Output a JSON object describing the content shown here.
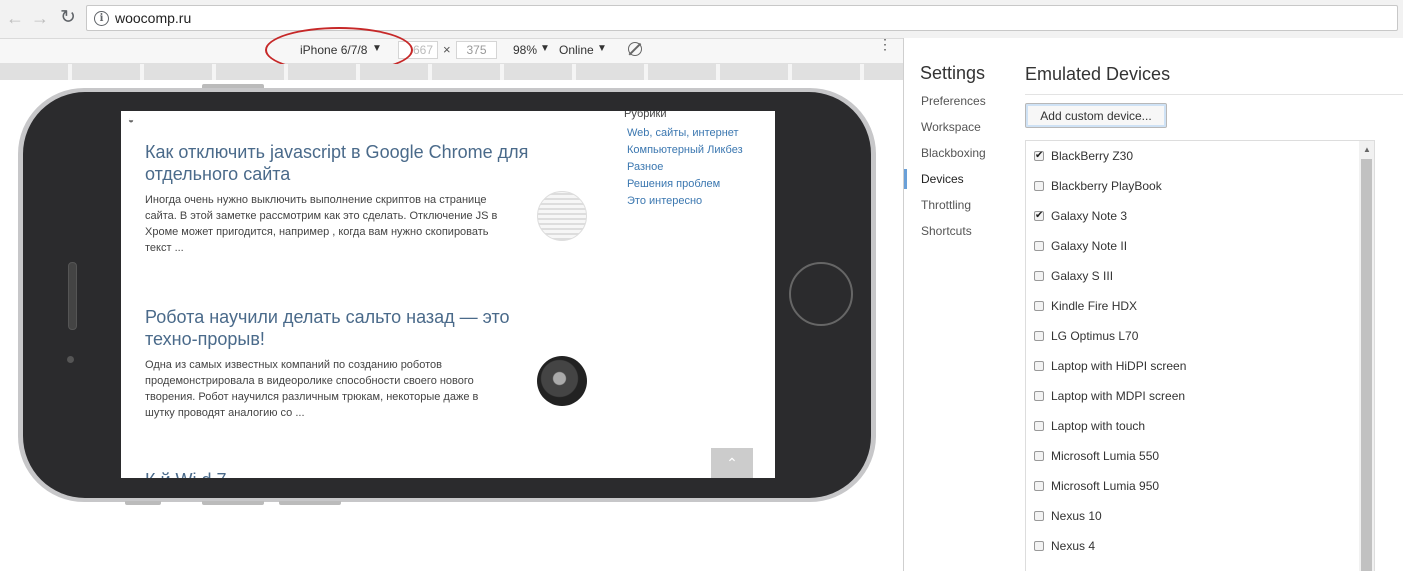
{
  "browser": {
    "url": "woocomp.ru",
    "back_icon": "←",
    "forward_icon": "→",
    "reload_icon": "↻",
    "info_icon": "i"
  },
  "device_toolbar": {
    "device": "iPhone 6/7/8",
    "width": "667",
    "times": "×",
    "height": "375",
    "zoom": "98%",
    "network": "Online",
    "caret": "▼",
    "kebab": "⋮",
    "highlight_color": "#c62828"
  },
  "screen": {
    "posts": [
      {
        "title": "Как отключить javascript в Google Chrome для отдельного сайта",
        "excerpt": "Иногда очень нужно выключить выполнение скриптов на странице сайта. В этой заметке рассмотрим как это сделать. Отключение JS в Хроме может пригодится, например , когда вам нужно скопировать текст ..."
      },
      {
        "title": "Робота научили делать сальто назад — это техно-прорыв!",
        "excerpt": "Одна из самых известных компаний по созданию роботов продемонстрировала в видеоролике способности своего нового творения. Робот научился различным трюкам, некоторые даже в шутку проводят аналогию со ..."
      }
    ],
    "cut_title": "К                    й                    Wi     d    7",
    "rubrics_title": "Рубрики",
    "rubrics": [
      "Web, сайты, интернет",
      "Компьютерный Ликбез",
      "Разное",
      "Решения проблем",
      "Это интересно"
    ],
    "scroll_top_icon": "⌃",
    "link_color": "#3b77b0"
  },
  "settings": {
    "title": "Settings",
    "nav": [
      "Preferences",
      "Workspace",
      "Blackboxing",
      "Devices",
      "Throttling",
      "Shortcuts"
    ],
    "active_nav": "Devices",
    "section_title": "Emulated Devices",
    "add_button": "Add custom device...",
    "devices": [
      {
        "name": "BlackBerry Z30",
        "checked": true
      },
      {
        "name": "Blackberry PlayBook",
        "checked": false
      },
      {
        "name": "Galaxy Note 3",
        "checked": true
      },
      {
        "name": "Galaxy Note II",
        "checked": false
      },
      {
        "name": "Galaxy S III",
        "checked": false
      },
      {
        "name": "Kindle Fire HDX",
        "checked": false
      },
      {
        "name": "LG Optimus L70",
        "checked": false
      },
      {
        "name": "Laptop with HiDPI screen",
        "checked": false
      },
      {
        "name": "Laptop with MDPI screen",
        "checked": false
      },
      {
        "name": "Laptop with touch",
        "checked": false
      },
      {
        "name": "Microsoft Lumia 550",
        "checked": false
      },
      {
        "name": "Microsoft Lumia 950",
        "checked": false
      },
      {
        "name": "Nexus 10",
        "checked": false
      },
      {
        "name": "Nexus 4",
        "checked": false
      }
    ],
    "check_mark": "✔",
    "scroll_up_icon": "▲"
  }
}
